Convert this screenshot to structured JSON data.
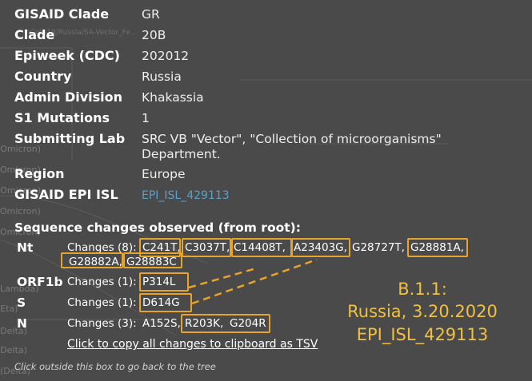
{
  "background": {
    "tree_labels": [
      "(Omicron)",
      "Omicron)",
      "(Omicron)",
      "Omicron)",
      "Omicron)",
      "Lambda)",
      "(Eta)",
      "(Delta)",
      "(Delta)",
      "(Delta)"
    ],
    "watermark": "hCoV-19/Russia/SA-Vector_Fe..."
  },
  "attributes": [
    {
      "key": "GISAID Clade",
      "value": "GR"
    },
    {
      "key": "Clade",
      "value": "20B"
    },
    {
      "key": "Epiweek (CDC)",
      "value": "202012"
    },
    {
      "key": "Country",
      "value": "Russia"
    },
    {
      "key": "Admin Division",
      "value": "Khakassia"
    },
    {
      "key": "S1 Mutations",
      "value": "1"
    },
    {
      "key": "Submitting Lab",
      "value": "SRC VB \"Vector\", \"Collection of microorganisms\" Department."
    },
    {
      "key": "Region",
      "value": "Europe"
    },
    {
      "key": "GISAID EPI ISL",
      "value": "EPI_ISL_429113"
    }
  ],
  "sequence_changes": {
    "title": "Sequence changes observed (from root):",
    "genes": [
      {
        "name": "Nt",
        "label": "Changes (8):",
        "mutations": [
          "C241T,",
          "C3037T,",
          "C14408T,",
          "A23403G,",
          "G28727T,",
          "G28881A,",
          "G28882A,",
          "G28883C"
        ]
      },
      {
        "name": "ORF1b",
        "label": "Changes (1):",
        "mutations": [
          "P314L"
        ]
      },
      {
        "name": "S",
        "label": "Changes (1):",
        "mutations": [
          "D614G"
        ]
      },
      {
        "name": "N",
        "label": "Changes (3):",
        "mutations": [
          "A152S,",
          "R203K,",
          "G204R"
        ]
      }
    ],
    "copy_link": "Click to copy all changes to clipboard as TSV",
    "footer": "Click outside this box to go back to the tree"
  },
  "annotation": {
    "line1": "B.1.1:",
    "line2": "Russia, 3.20.2020",
    "line3": "EPI_ISL_429113",
    "color": "#f0c040",
    "box_color": "#e8a42a"
  }
}
